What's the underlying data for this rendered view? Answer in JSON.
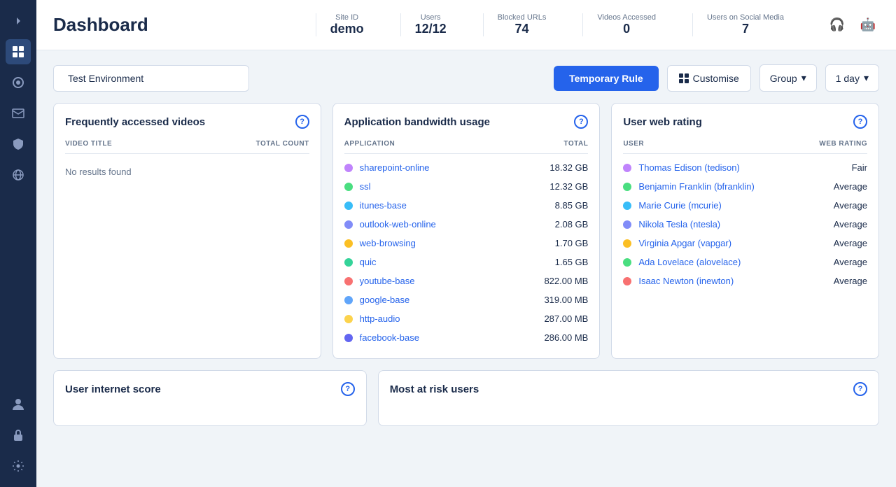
{
  "sidebar": {
    "items": [
      {
        "name": "collapse-icon",
        "icon": "→",
        "active": false
      },
      {
        "name": "dashboard-icon",
        "icon": "⊞",
        "active": true
      },
      {
        "name": "chart-icon",
        "icon": "◎",
        "active": false
      },
      {
        "name": "mail-icon",
        "icon": "✉",
        "active": false
      },
      {
        "name": "shield-icon",
        "icon": "⛊",
        "active": false
      },
      {
        "name": "network-icon",
        "icon": "⊕",
        "active": false
      },
      {
        "name": "user-icon",
        "icon": "👤",
        "active": false
      },
      {
        "name": "lock-icon",
        "icon": "🔒",
        "active": false
      }
    ]
  },
  "header": {
    "title": "Dashboard",
    "stats": [
      {
        "label": "Site ID",
        "value": "demo"
      },
      {
        "label": "Users",
        "value": "12/12"
      },
      {
        "label": "Blocked URLs",
        "value": "74"
      },
      {
        "label": "Videos Accessed",
        "value": "0"
      },
      {
        "label": "Users on Social Media",
        "value": "7"
      }
    ],
    "icon1": "🎧",
    "icon2": "🤖"
  },
  "topbar": {
    "env_label": "Test Environment",
    "temp_rule_label": "Temporary Rule",
    "customise_label": "Customise",
    "group_label": "Group",
    "day_label": "1 day"
  },
  "videos_card": {
    "title": "Frequently accessed videos",
    "col_title": "VIDEO TITLE",
    "col_count": "TOTAL COUNT",
    "no_results": "No results found"
  },
  "bandwidth_card": {
    "title": "Application bandwidth usage",
    "col_app": "APPLICATION",
    "col_total": "TOTAL",
    "apps": [
      {
        "name": "sharepoint-online",
        "total": "18.32 GB",
        "color": "#c084fc"
      },
      {
        "name": "ssl",
        "total": "12.32 GB",
        "color": "#4ade80"
      },
      {
        "name": "itunes-base",
        "total": "8.85 GB",
        "color": "#38bdf8"
      },
      {
        "name": "outlook-web-online",
        "total": "2.08 GB",
        "color": "#818cf8"
      },
      {
        "name": "web-browsing",
        "total": "1.70 GB",
        "color": "#fbbf24"
      },
      {
        "name": "quic",
        "total": "1.65 GB",
        "color": "#34d399"
      },
      {
        "name": "youtube-base",
        "total": "822.00 MB",
        "color": "#f87171"
      },
      {
        "name": "google-base",
        "total": "319.00 MB",
        "color": "#60a5fa"
      },
      {
        "name": "http-audio",
        "total": "287.00 MB",
        "color": "#fcd34d"
      },
      {
        "name": "facebook-base",
        "total": "286.00 MB",
        "color": "#6366f1"
      }
    ]
  },
  "webrating_card": {
    "title": "User web rating",
    "col_user": "USER",
    "col_rating": "WEB RATING",
    "users": [
      {
        "name": "Thomas Edison (tedison)",
        "rating": "Fair",
        "color": "#c084fc"
      },
      {
        "name": "Benjamin Franklin (bfranklin)",
        "rating": "Average",
        "color": "#4ade80"
      },
      {
        "name": "Marie Curie (mcurie)",
        "rating": "Average",
        "color": "#38bdf8"
      },
      {
        "name": "Nikola Tesla (ntesla)",
        "rating": "Average",
        "color": "#818cf8"
      },
      {
        "name": "Virginia Apgar (vapgar)",
        "rating": "Average",
        "color": "#fbbf24"
      },
      {
        "name": "Ada Lovelace (alovelace)",
        "rating": "Average",
        "color": "#4ade80"
      },
      {
        "name": "Isaac Newton (inewton)",
        "rating": "Average",
        "color": "#f87171"
      }
    ]
  },
  "bottom": {
    "internet_score_title": "User internet score",
    "most_at_risk_title": "Most at risk users"
  }
}
